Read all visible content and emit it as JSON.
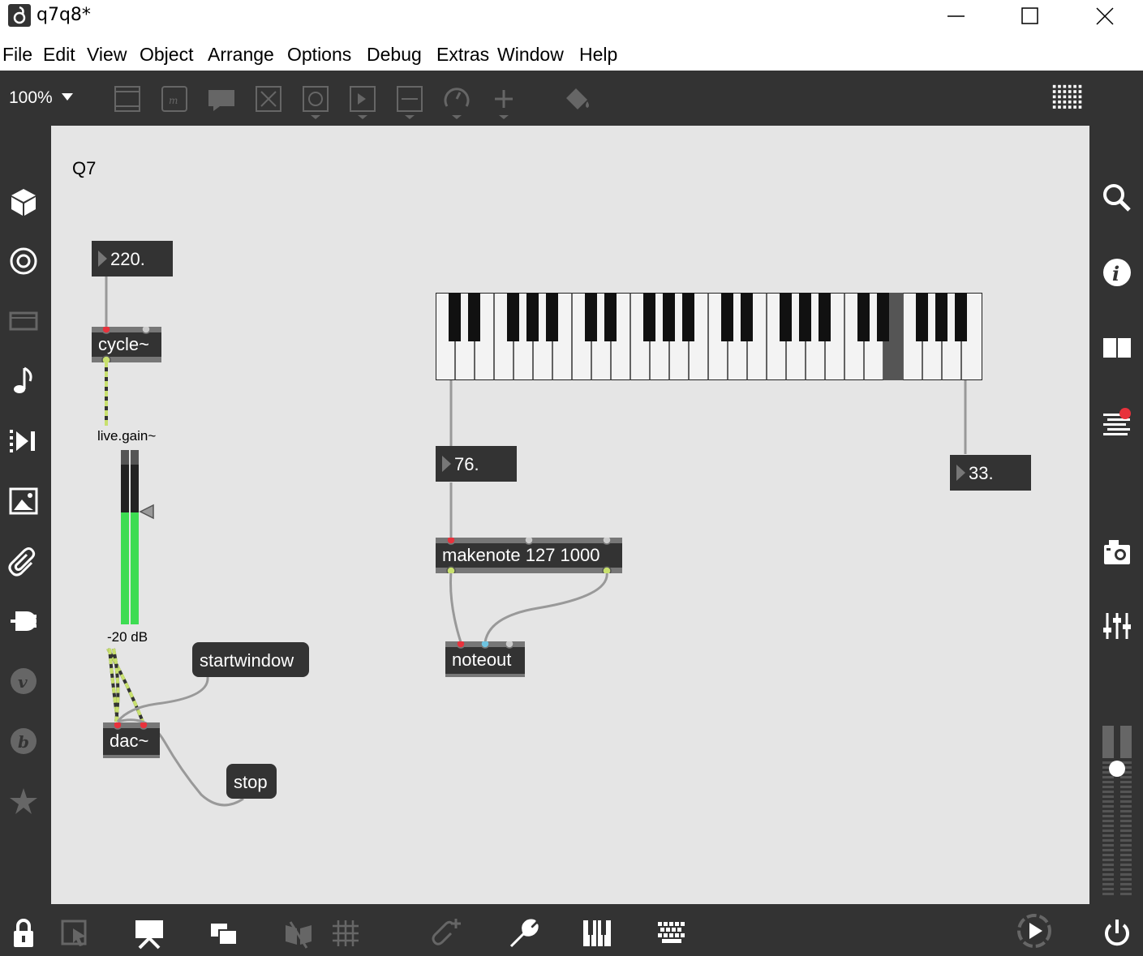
{
  "window": {
    "title": "q7q8*"
  },
  "menu": [
    "File",
    "Edit",
    "View",
    "Object",
    "Arrange",
    "Options",
    "Debug",
    "Extras",
    "Window",
    "Help"
  ],
  "toolbar": {
    "zoom": "100%"
  },
  "patcher": {
    "comment": "Q7",
    "number_freq": "220.",
    "cycle": "cycle~",
    "gain_label": "live.gain~",
    "gain_value": "-20 dB",
    "gain_level": 0.63,
    "dac": "dac~",
    "msg_start": "startwindow",
    "msg_stop": "stop",
    "number_note": "76.",
    "number_velocity": "33.",
    "makenote": "makenote 127 1000",
    "noteout": "noteout"
  },
  "colors": {
    "accent_red": "#e8323c",
    "meter_green": "#3ddc52",
    "canvas": "#e5e5e5"
  }
}
